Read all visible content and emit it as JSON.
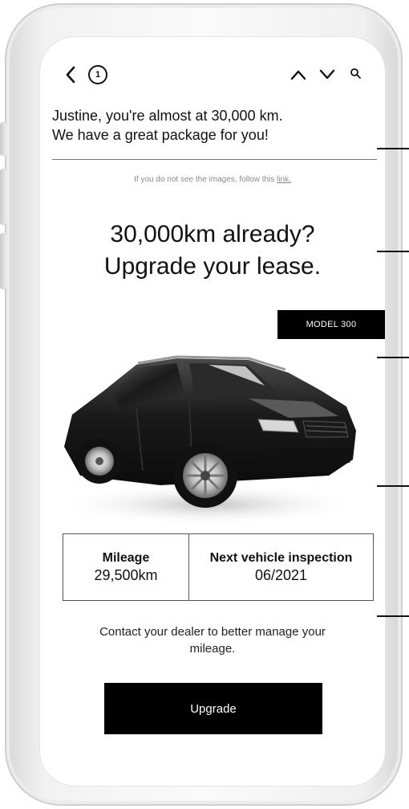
{
  "nav": {
    "message_count": "1"
  },
  "email": {
    "greeting_line1": "Justine, you're almost at 30,000 km.",
    "greeting_line2": "We have a great package for you!",
    "preheader_text": "If you do not see the images, follow this ",
    "preheader_link": "link.",
    "headline_line1": "30,000km already?",
    "headline_line2": "Upgrade your lease.",
    "model_tag": "MODEL 300",
    "mileage_label": "Mileage",
    "mileage_value": "29,500km",
    "inspection_label": "Next vehicle inspection",
    "inspection_value": "06/2021",
    "contact_text": "Contact your dealer to better manage your mileage.",
    "cta_label": "Upgrade"
  },
  "icons": {
    "back": "chevron-left-icon",
    "up": "chevron-up-icon",
    "down": "chevron-down-icon",
    "search": "search-icon"
  },
  "colors": {
    "accent": "#000000",
    "background": "#ffffff",
    "muted_text": "#8a8a8a"
  }
}
